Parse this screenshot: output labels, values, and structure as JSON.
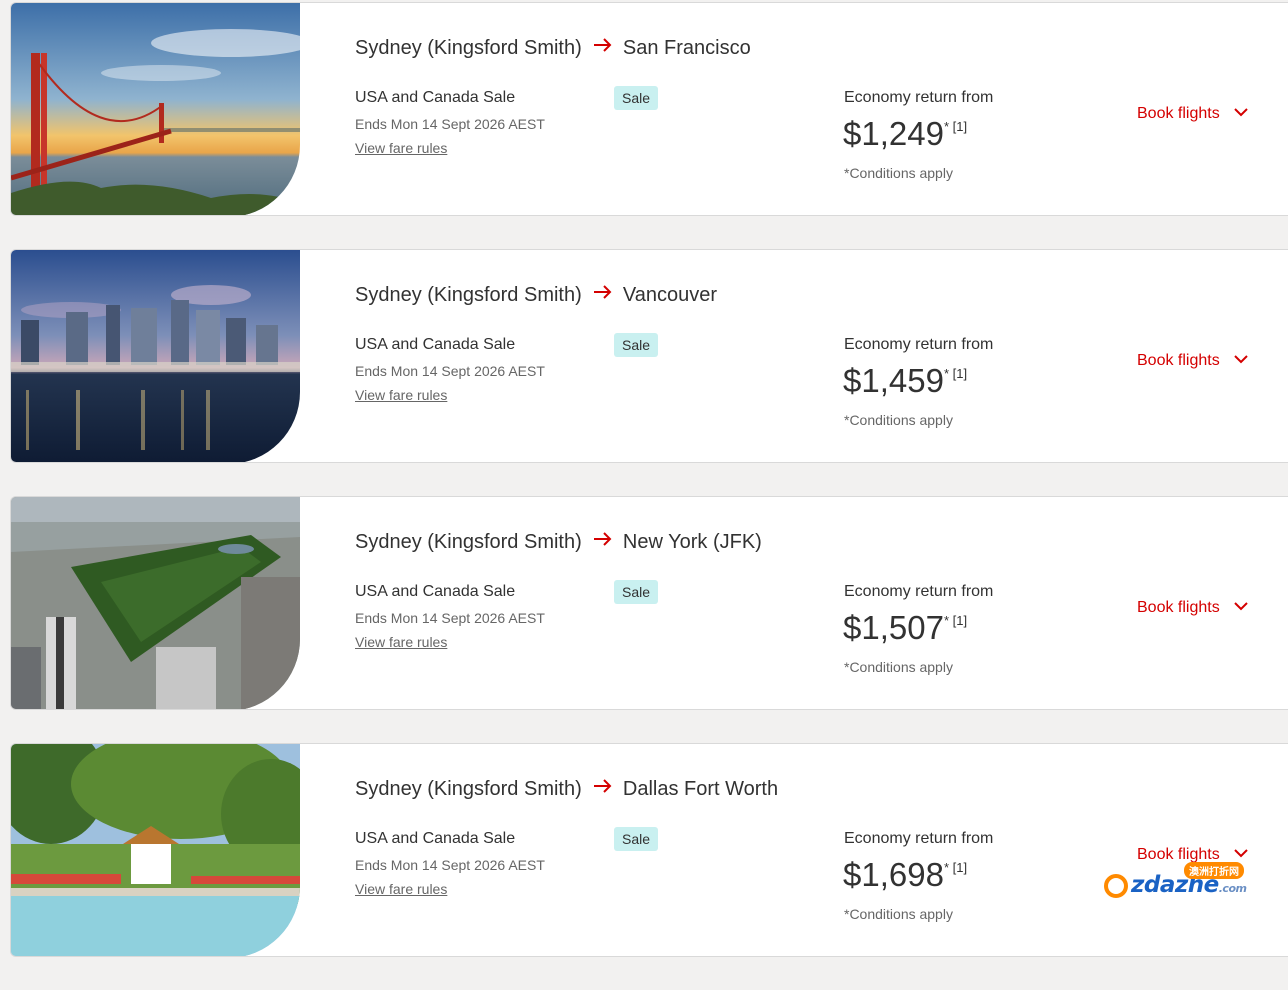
{
  "colors": {
    "accent": "#d40000",
    "badge_bg": "#c9f0f0",
    "page_bg": "#f2f1f0",
    "card_bg": "#ffffff"
  },
  "cards": [
    {
      "origin": "Sydney (Kingsford Smith)",
      "destination": "San Francisco",
      "sale_name": "USA and Canada Sale",
      "badge": "Sale",
      "ends": "Ends Mon 14 Sept 2026 AEST",
      "fare_rules": "View fare rules",
      "price_label": "Economy return from",
      "price": "$1,249",
      "price_note": "* [1]",
      "conditions": "*Conditions apply",
      "book": "Book flights",
      "image": "golden-gate-bridge-sunset"
    },
    {
      "origin": "Sydney (Kingsford Smith)",
      "destination": "Vancouver",
      "sale_name": "USA and Canada Sale",
      "badge": "Sale",
      "ends": "Ends Mon 14 Sept 2026 AEST",
      "fare_rules": "View fare rules",
      "price_label": "Economy return from",
      "price": "$1,459",
      "price_note": "* [1]",
      "conditions": "*Conditions apply",
      "book": "Book flights",
      "image": "vancouver-skyline-dusk"
    },
    {
      "origin": "Sydney (Kingsford Smith)",
      "destination": "New York (JFK)",
      "sale_name": "USA and Canada Sale",
      "badge": "Sale",
      "ends": "Ends Mon 14 Sept 2026 AEST",
      "fare_rules": "View fare rules",
      "price_label": "Economy return from",
      "price": "$1,507",
      "price_note": "* [1]",
      "conditions": "*Conditions apply",
      "book": "Book flights",
      "image": "central-park-aerial"
    },
    {
      "origin": "Sydney (Kingsford Smith)",
      "destination": "Dallas Fort Worth",
      "sale_name": "USA and Canada Sale",
      "badge": "Sale",
      "ends": "Ends Mon 14 Sept 2026 AEST",
      "fare_rules": "View fare rules",
      "price_label": "Economy return from",
      "price": "$1,698",
      "price_note": "* [1]",
      "conditions": "*Conditions apply",
      "book": "Book flights",
      "image": "dallas-garden-gazebo"
    }
  ],
  "watermark": {
    "tag": "澳洲打折网",
    "name": "zdazhe",
    "suffix": ".com"
  }
}
